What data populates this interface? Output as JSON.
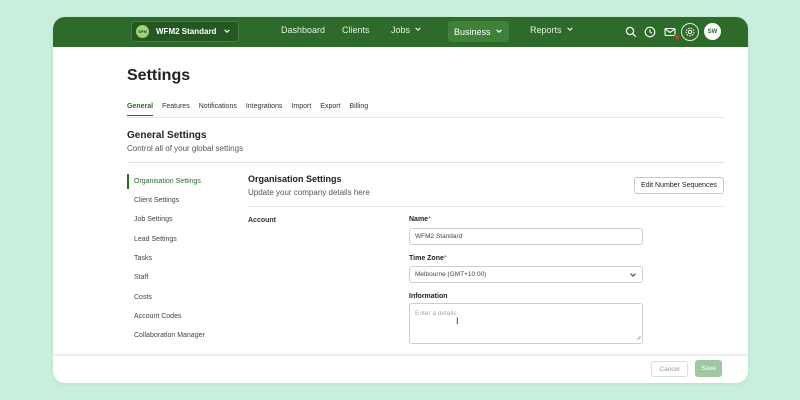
{
  "topbar": {
    "org_logo": "WFM",
    "org_name": "WFM2 Standard",
    "nav": [
      {
        "label": "Dashboard"
      },
      {
        "label": "Clients"
      },
      {
        "label": "Jobs"
      },
      {
        "label": "Business"
      },
      {
        "label": "Reports"
      }
    ],
    "avatar_initials": "SW",
    "icons": [
      "search-icon",
      "clock-icon",
      "mail-icon",
      "gear-icon"
    ]
  },
  "page": {
    "title": "Settings",
    "tabs": [
      {
        "label": "General"
      },
      {
        "label": "Features"
      },
      {
        "label": "Notifications"
      },
      {
        "label": "Integrations"
      },
      {
        "label": "Import"
      },
      {
        "label": "Export"
      },
      {
        "label": "Billing"
      }
    ],
    "section_title": "General Settings",
    "section_subtitle": "Control all of your global settings"
  },
  "sidebar": {
    "items": [
      {
        "label": "Organisation Settings"
      },
      {
        "label": "Client Settings"
      },
      {
        "label": "Job Settings"
      },
      {
        "label": "Lead Settings"
      },
      {
        "label": "Tasks"
      },
      {
        "label": "Staff"
      },
      {
        "label": "Costs"
      },
      {
        "label": "Account Codes"
      },
      {
        "label": "Collaboration Manager"
      }
    ]
  },
  "org_settings": {
    "title": "Organisation Settings",
    "subtitle": "Update your company details here",
    "edit_sequences_label": "Edit Number Sequences",
    "account_label": "Account",
    "name_label": "Name",
    "name_value": "WFM2 Standard",
    "timezone_label": "Time Zone",
    "timezone_value": "Melbourne (GMT+10:00)",
    "information_label": "Information",
    "information_placeholder": "Enter a details",
    "required_mark": "*"
  },
  "footer": {
    "cancel_label": "Cancel",
    "save_label": "Save"
  },
  "colors": {
    "brand": "#2e6b2a",
    "background": "#c9efdc",
    "save_disabled": "#9fc7a0"
  }
}
